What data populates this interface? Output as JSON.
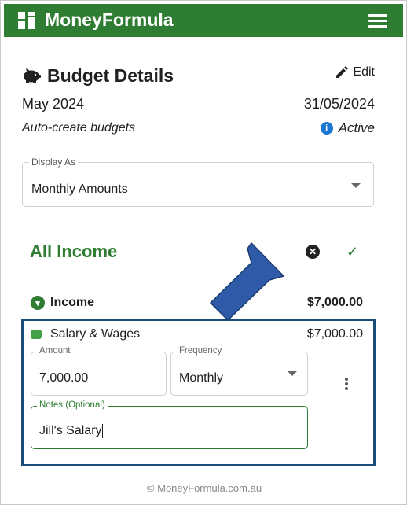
{
  "app": {
    "brand": "MoneyFormula",
    "brand_color": "#2e7d32"
  },
  "budget": {
    "title": "Budget Details",
    "edit_label": "Edit",
    "period": "May 2024",
    "end_date": "31/05/2024",
    "auto_create_label": "Auto-create budgets",
    "status": "Active"
  },
  "display_as": {
    "label": "Display As",
    "value": "Monthly Amounts"
  },
  "group": {
    "title": "All Income"
  },
  "income": {
    "label": "Income",
    "amount": "$7,000.00"
  },
  "category": {
    "name": "Salary & Wages",
    "amount": "$7,000.00",
    "amount_field": {
      "label": "Amount",
      "value": "7,000.00"
    },
    "frequency_field": {
      "label": "Frequency",
      "value": "Monthly"
    },
    "notes_field": {
      "label": "Notes (Optional)",
      "value": "Jill's Salary"
    }
  },
  "footer": {
    "text": "© MoneyFormula.com.au"
  },
  "colors": {
    "highlight": "#1a4e79",
    "arrow": "#2f5aa8",
    "info": "#1976d2"
  }
}
